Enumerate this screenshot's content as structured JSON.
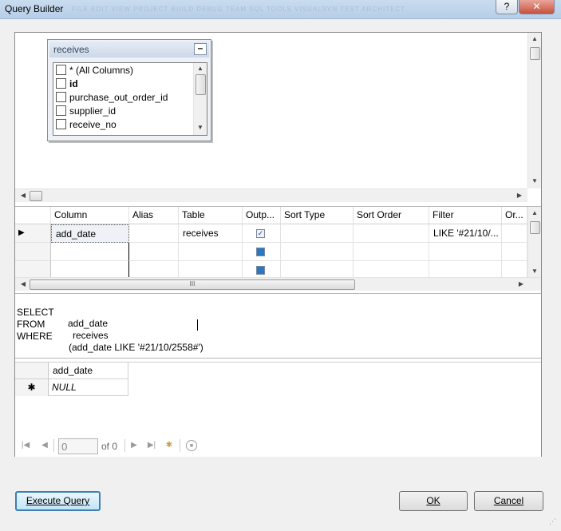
{
  "window": {
    "title": "Query Builder",
    "background_menu_text": "FILE   EDIT   VIEW   PROJECT   BUILD   DEBUG   TEAM   SQL   TOOLS   VISUALSVN   TEST   ARCHITECT",
    "help_label": "?",
    "close_label": "✕"
  },
  "diagram": {
    "table_name": "receives",
    "minimize_label": "–",
    "columns": [
      {
        "label": "* (All Columns)",
        "bold": false,
        "checked": false
      },
      {
        "label": "id",
        "bold": true,
        "checked": false
      },
      {
        "label": "purchase_out_order_id",
        "bold": false,
        "checked": false
      },
      {
        "label": "supplier_id",
        "bold": false,
        "checked": false
      },
      {
        "label": "receive_no",
        "bold": false,
        "checked": false
      }
    ]
  },
  "criteria_grid": {
    "headers": [
      "Column",
      "Alias",
      "Table",
      "Outp...",
      "Sort Type",
      "Sort Order",
      "Filter",
      "Or..."
    ],
    "rows": [
      {
        "column": "add_date",
        "alias": "",
        "table": "receives",
        "output": true,
        "sort_type": "",
        "sort_order": "",
        "filter": "LIKE '#21/10/...",
        "or": ""
      },
      {
        "column": "",
        "alias": "",
        "table": "",
        "output": false,
        "sort_type": "",
        "sort_order": "",
        "filter": "",
        "or": ""
      },
      {
        "column": "",
        "alias": "",
        "table": "",
        "output": false,
        "sort_type": "",
        "sort_order": "",
        "filter": "",
        "or": ""
      }
    ],
    "scroll_grip": "III"
  },
  "sql": {
    "lines": [
      {
        "keyword": "SELECT",
        "value": "add_date"
      },
      {
        "keyword": "FROM",
        "value": "receives"
      },
      {
        "keyword": "WHERE",
        "value": "(add_date LIKE '#21/10/2558#')"
      }
    ]
  },
  "results": {
    "column_header": "add_date",
    "new_row_marker": "✱",
    "null_value": "NULL",
    "navigator": {
      "position_value": "0",
      "of_label": "of 0"
    }
  },
  "buttons": {
    "execute_query": "Execute Query",
    "ok": "OK",
    "cancel": "Cancel"
  },
  "colors": {
    "primary_button_border": "#3c7fb1",
    "checkbox_blue": "#2b78c2"
  }
}
